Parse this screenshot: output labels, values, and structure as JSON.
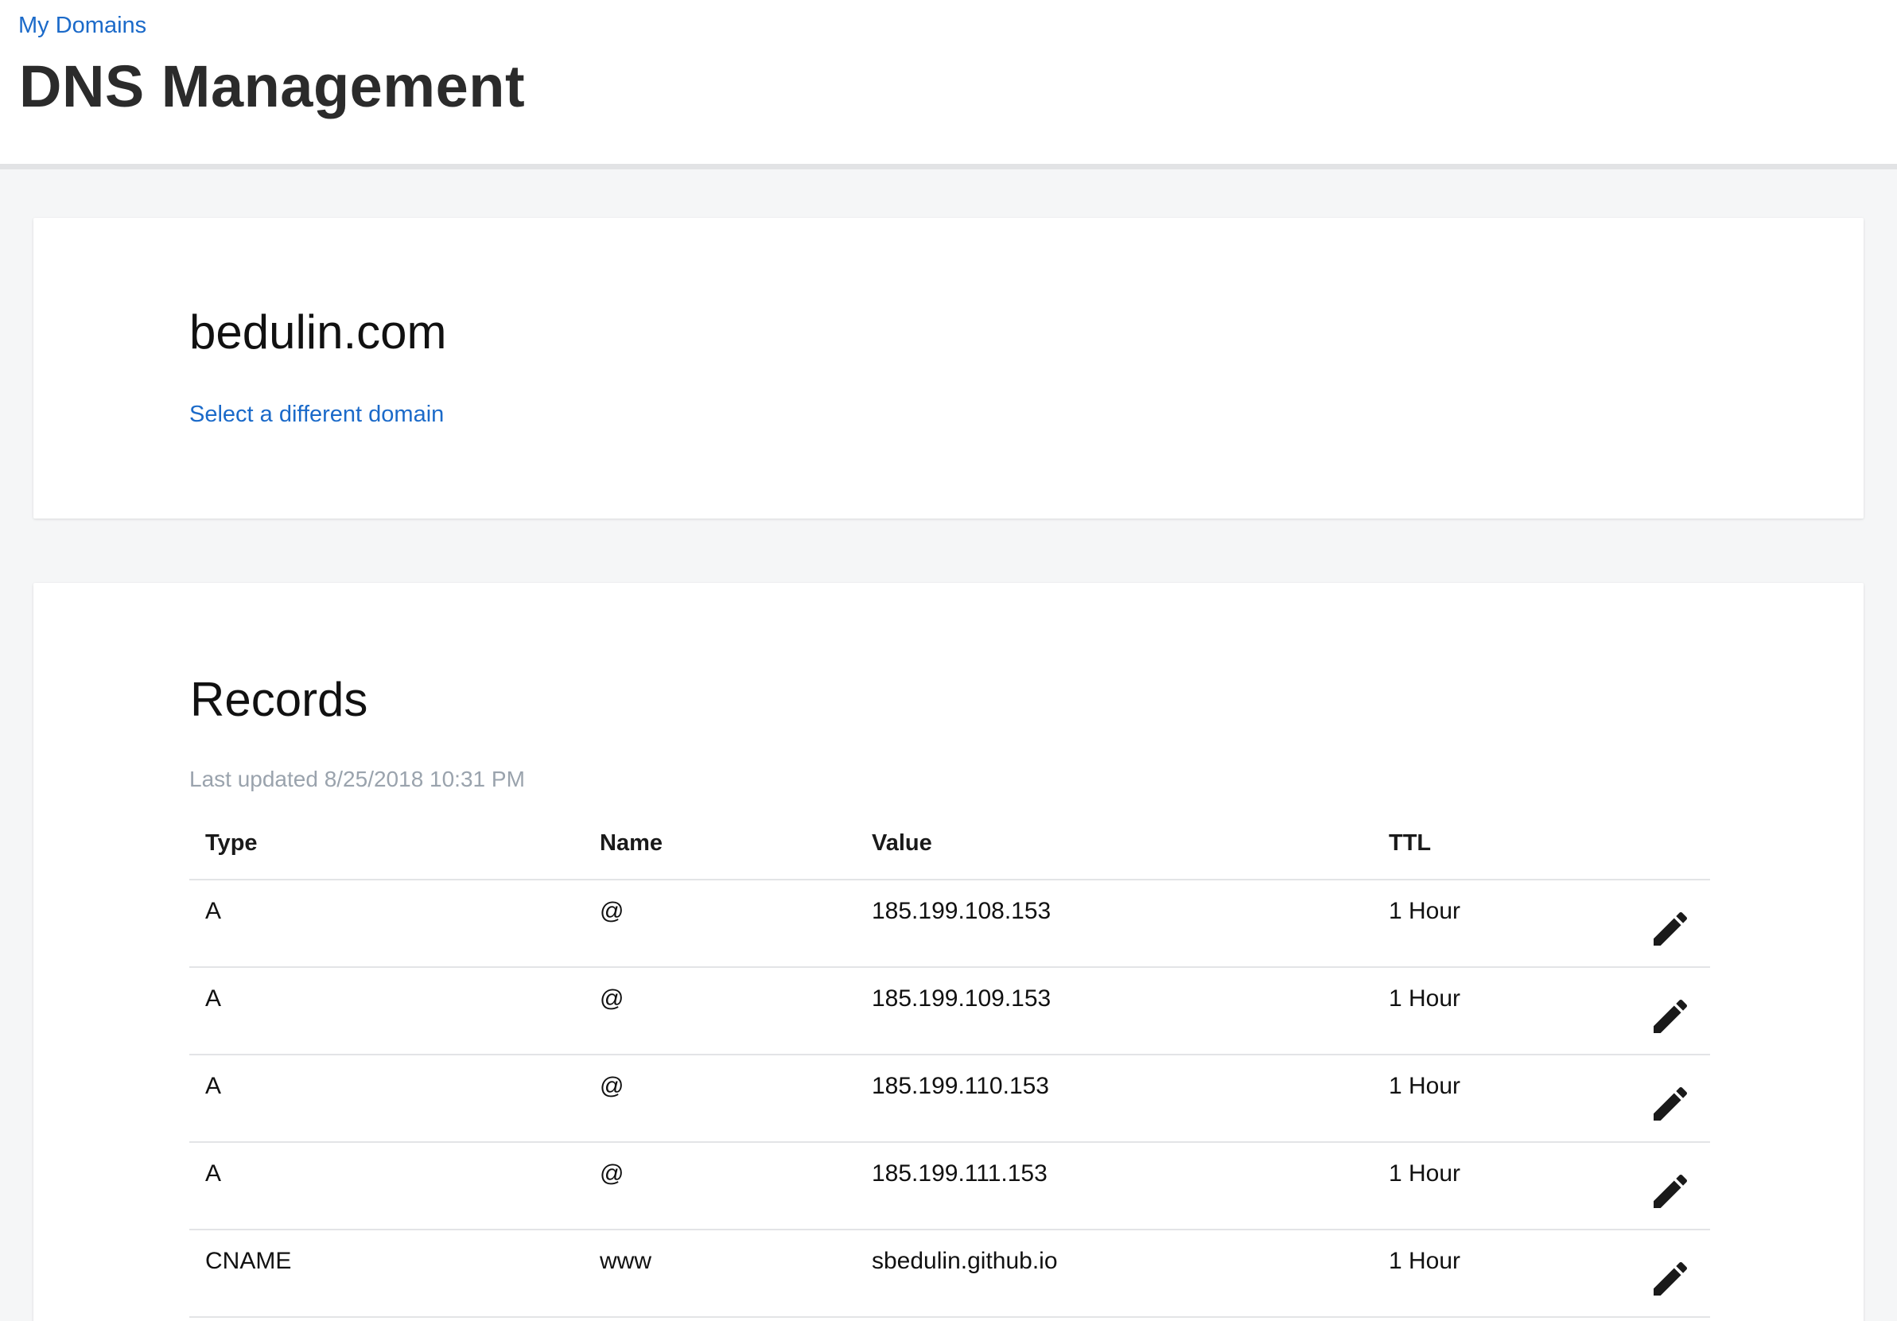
{
  "header": {
    "breadcrumb": "My Domains",
    "title": "DNS Management"
  },
  "domain_card": {
    "domain_name": "bedulin.com",
    "change_link": "Select a different domain"
  },
  "records": {
    "title": "Records",
    "last_updated": "Last updated 8/25/2018 10:31 PM",
    "columns": {
      "type": "Type",
      "name": "Name",
      "value": "Value",
      "ttl": "TTL"
    },
    "rows": [
      {
        "type": "A",
        "name": "@",
        "value": "185.199.108.153",
        "ttl": "1 Hour"
      },
      {
        "type": "A",
        "name": "@",
        "value": "185.199.109.153",
        "ttl": "1 Hour"
      },
      {
        "type": "A",
        "name": "@",
        "value": "185.199.110.153",
        "ttl": "1 Hour"
      },
      {
        "type": "A",
        "name": "@",
        "value": "185.199.111.153",
        "ttl": "1 Hour"
      },
      {
        "type": "CNAME",
        "name": "www",
        "value": "sbedulin.github.io",
        "ttl": "1 Hour"
      }
    ],
    "edit_icon": "pencil-icon"
  },
  "colors": {
    "link": "#1b6ac9",
    "muted_text": "#9aa3ad",
    "page_background": "#f5f6f7",
    "divider": "#e3e4e6"
  }
}
